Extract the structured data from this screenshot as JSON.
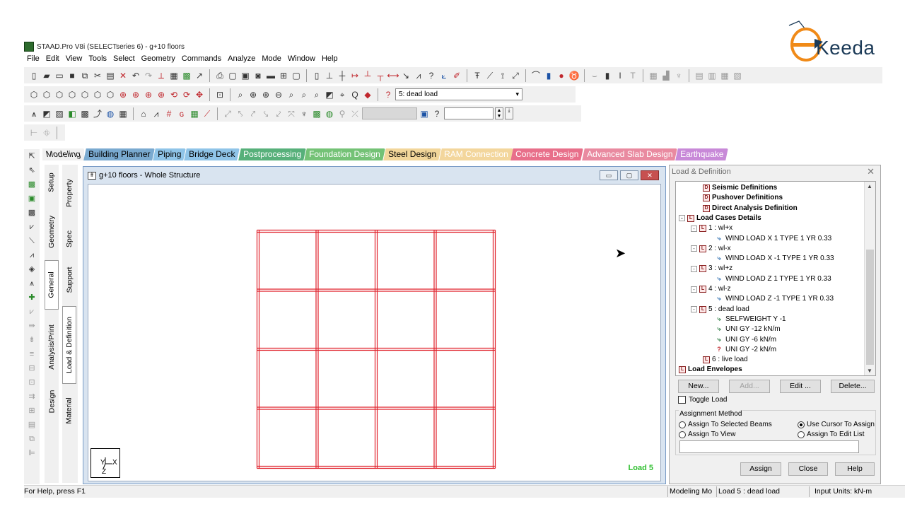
{
  "brand": {
    "logo_text": "Keeda"
  },
  "window": {
    "title": "STAAD.Pro V8i (SELECTseries 6) - g+10 floors"
  },
  "menu": [
    "File",
    "Edit",
    "View",
    "Tools",
    "Select",
    "Geometry",
    "Commands",
    "Analyze",
    "Mode",
    "Window",
    "Help"
  ],
  "toolbar": {
    "loadcase_selected": "5: dead load"
  },
  "page_tabs": [
    {
      "label": "Modeling",
      "color": "#f0f0f0",
      "text": "#000000"
    },
    {
      "label": "Building Planner",
      "color": "#7aaad0",
      "text": "#000000"
    },
    {
      "label": "Piping",
      "color": "#8fc4e8",
      "text": "#000000"
    },
    {
      "label": "Bridge Deck",
      "color": "#8fc4e8",
      "text": "#000000"
    },
    {
      "label": "Postprocessing",
      "color": "#57b07a",
      "text": "#ffffff"
    },
    {
      "label": "Foundation Design",
      "color": "#74c276",
      "text": "#ffffff"
    },
    {
      "label": "Steel Design",
      "color": "#f2d69a",
      "text": "#000000"
    },
    {
      "label": "RAM Connection",
      "color": "#f3d69c",
      "text": "#ffffff"
    },
    {
      "label": "Concrete Design",
      "color": "#e86f8a",
      "text": "#ffffff"
    },
    {
      "label": "Advanced Slab Design",
      "color": "#e98aa0",
      "text": "#ffffff"
    },
    {
      "label": "Earthquake",
      "color": "#c889d8",
      "text": "#ffffff"
    }
  ],
  "side_tabs_a": [
    "Setup",
    "Geometry",
    "General",
    "Analysis/Print",
    "Design"
  ],
  "side_tabs_b": [
    "Property",
    "Spec",
    "Support",
    "Load & Definition",
    "Material"
  ],
  "structure_window": {
    "title": "g+10 floors - Whole Structure",
    "axis": {
      "y": "Y",
      "x": "X",
      "z": "Z"
    },
    "load_label": "Load 5",
    "grid": {
      "cols": 4,
      "rows": 4,
      "color": "#e0202a"
    }
  },
  "ld_panel": {
    "title": "Load & Definition",
    "tree": [
      {
        "label": "Seismic Definitions",
        "icon": "D",
        "bold": true,
        "indent": 2
      },
      {
        "label": "Pushover Definitions",
        "icon": "D",
        "bold": true,
        "indent": 2
      },
      {
        "label": "Direct Analysis Definition",
        "icon": "D",
        "bold": true,
        "indent": 2
      },
      {
        "label": "Load Cases Details",
        "icon": "L",
        "bold": true,
        "indent": 0,
        "expander": "-"
      },
      {
        "label": "1 : wl+x",
        "icon": "L",
        "bold": false,
        "indent": 1,
        "expander": "-"
      },
      {
        "label": "WIND LOAD X 1 TYPE 1 YR 0.33",
        "icon": "w",
        "bold": false,
        "indent": 3
      },
      {
        "label": "2 : wl-x",
        "icon": "L",
        "bold": false,
        "indent": 1,
        "expander": "-"
      },
      {
        "label": "WIND LOAD X -1 TYPE 1 YR 0.33",
        "icon": "w",
        "bold": false,
        "indent": 3
      },
      {
        "label": "3 : wl+z",
        "icon": "L",
        "bold": false,
        "indent": 1,
        "expander": "-"
      },
      {
        "label": "WIND LOAD Z 1 TYPE 1 YR 0.33",
        "icon": "w",
        "bold": false,
        "indent": 3
      },
      {
        "label": "4 : wl-z",
        "icon": "L",
        "bold": false,
        "indent": 1,
        "expander": "-"
      },
      {
        "label": "WIND LOAD Z -1 TYPE 1 YR 0.33",
        "icon": "w",
        "bold": false,
        "indent": 3
      },
      {
        "label": "5 : dead load",
        "icon": "L",
        "bold": false,
        "indent": 1,
        "expander": "-"
      },
      {
        "label": "SELFWEIGHT Y -1",
        "icon": "g",
        "bold": false,
        "indent": 3
      },
      {
        "label": "UNI GY -12 kN/m",
        "icon": "g",
        "bold": false,
        "indent": 3
      },
      {
        "label": "UNI GY -6 kN/m",
        "icon": "g",
        "bold": false,
        "indent": 3
      },
      {
        "label": "UNI GY -2 kN/m",
        "icon": "q",
        "bold": false,
        "indent": 3
      },
      {
        "label": "6 : live load",
        "icon": "L",
        "bold": false,
        "indent": 2
      },
      {
        "label": "Load Envelopes",
        "icon": "L",
        "bold": true,
        "indent": 0
      }
    ],
    "buttons": {
      "new": "New...",
      "add": "Add...",
      "edit": "Edit ...",
      "delete": "Delete..."
    },
    "toggle_load": "Toggle Load",
    "assign_method": "Assignment Method",
    "radios": {
      "selected_beams": "Assign To Selected Beams",
      "view": "Assign To View",
      "cursor": "Use Cursor To Assign",
      "edit_list": "Assign To Edit List"
    },
    "footer_buttons": {
      "assign": "Assign",
      "close": "Close",
      "help": "Help"
    }
  },
  "status": {
    "help": "For Help, press F1",
    "mode": "Modeling Mo",
    "load": "Load 5 : dead load",
    "units": "Input Units:  kN-m"
  }
}
